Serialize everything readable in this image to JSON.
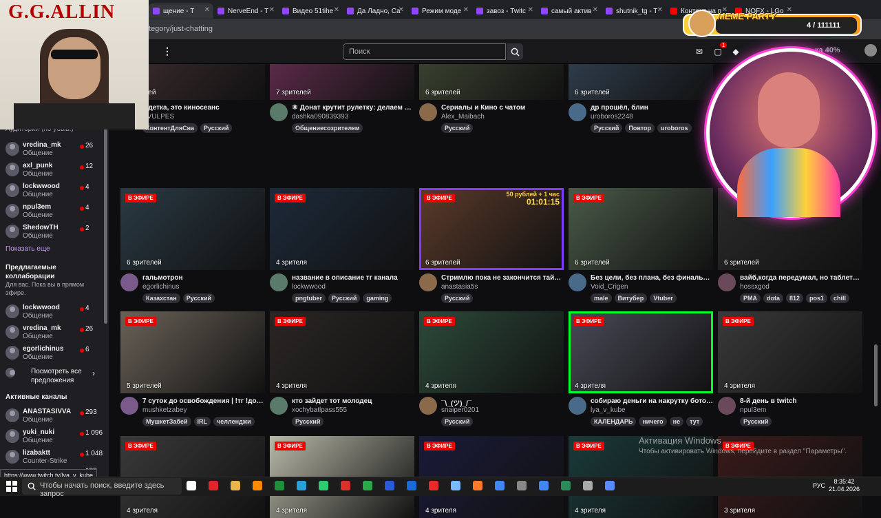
{
  "browser": {
    "tabs": [
      "щение - T",
      "NerveEnd - T",
      "Видео 51tihe",
      "Да Ладно, Са",
      "Режим моде",
      "завоз - Twitc",
      "самый актив",
      "shutnik_tg - T",
      "Контент на п",
      "NOFX - LGo"
    ],
    "url": "tegory/just-chatting"
  },
  "topnav": {
    "search_placeholder": "Поиск",
    "prime_text": "ка 40%",
    "notif_count": "1"
  },
  "sidebar": {
    "section_label": "Аудитории (по убыв.)",
    "followed": [
      {
        "name": "vredina_mk",
        "category": "Общение",
        "viewers": "26"
      },
      {
        "name": "axl_punk",
        "category": "Общение",
        "viewers": "12"
      },
      {
        "name": "lockwwood",
        "category": "Общение",
        "viewers": "4"
      },
      {
        "name": "npul3em",
        "category": "Общение",
        "viewers": "4"
      },
      {
        "name": "ShedowTH",
        "category": "Общение",
        "viewers": "2"
      }
    ],
    "show_more": "Показать еще",
    "collab_title": "Предлагаемые коллаборации",
    "collab_sub": "Для вас. Пока вы в прямом эфире.",
    "collabs": [
      {
        "name": "lockwwood",
        "category": "Общение",
        "viewers": "4"
      },
      {
        "name": "vredina_mk",
        "category": "Общение",
        "viewers": "26"
      },
      {
        "name": "egorlichinus",
        "category": "Общение",
        "viewers": "6"
      }
    ],
    "see_all": "Посмотреть все предложения",
    "active_title": "Активные каналы",
    "active": [
      {
        "name": "ANASTASIVVA",
        "category": "Общение",
        "viewers": "293"
      },
      {
        "name": "yuki_nuki",
        "category": "Общение",
        "viewers": "1 096"
      },
      {
        "name": "lizabaktt",
        "category": "Counter-Strike",
        "viewers": "1 048"
      },
      {
        "name": "",
        "category": "",
        "viewers": "128"
      }
    ]
  },
  "overlay": {
    "gg_allin": "G.G.ALLIN",
    "meme_title": "MEME PARTY",
    "meme_count": "4 / 111111"
  },
  "live_label": "В ЭФИРЕ",
  "cards": [
    {
      "viewers": "зрителей",
      "title": "а детка, это киносеанс",
      "channel": "EVULPES",
      "tags": [
        "КонтентДляСна",
        "Русский"
      ],
      "live": false
    },
    {
      "viewers": "7 зрителей",
      "title": "⚛ Донат крутит рулетку: делаем за…",
      "channel": "dashka090839393",
      "tags": [
        "Общениесозрителем"
      ],
      "live": false
    },
    {
      "viewers": "6 зрителей",
      "title": "Сериалы и Кино с чатом",
      "channel": "Alex_Maibach",
      "tags": [
        "Русский"
      ],
      "live": false
    },
    {
      "viewers": "6 зрителей",
      "title": "др прошёл, блин",
      "channel": "uroboros2248",
      "tags": [
        "Русский",
        "Повтор",
        "uroboros"
      ],
      "live": false
    },
    {
      "viewers": "6 зрителей",
      "title": "гальмотрон",
      "channel": "egorlichinus",
      "tags": [
        "Казахстан",
        "Русский"
      ],
      "live": true
    },
    {
      "viewers": "4 зрителя",
      "title": "название в описание тг канала",
      "channel": "lockwwood",
      "tags": [
        "pngtuber",
        "Русский",
        "gaming"
      ],
      "live": true
    },
    {
      "viewers": "6 зрителей",
      "title": "Стримлю пока не закончится таймер",
      "channel": "anastasia5s",
      "tags": [
        "Русский"
      ],
      "live": true,
      "sponsor": "50 рублей + 1 час",
      "timer": "01:01:15"
    },
    {
      "viewers": "6 зрителей",
      "title": "Без цели, без плана, без финального…",
      "channel": "Void_Crigen",
      "tags": [
        "male",
        "Витубер",
        "Vtuber"
      ],
      "live": true
    },
    {
      "viewers": "6 зрителей",
      "title": "вайб,когда передумал, но таблетки …",
      "channel": "hossxgod",
      "tags": [
        "PMA",
        "dota",
        "812",
        "pos1",
        "chill"
      ],
      "live": false
    },
    {
      "viewers": "5 зрителей",
      "title": "7 суток до освобождения | !тг !донат",
      "channel": "mushketzabey",
      "tags": [
        "МушкетЗабей",
        "IRL",
        "челленджи"
      ],
      "live": true
    },
    {
      "viewers": "4 зрителя",
      "title": "кто зайдет тот молодец",
      "channel": "xochybatlpass555",
      "tags": [
        "Русский"
      ],
      "live": true
    },
    {
      "viewers": "4 зрителя",
      "title": "¯\\_(ツ)_/¯",
      "channel": "snaiper0201",
      "tags": [
        "Русский"
      ],
      "live": true
    },
    {
      "viewers": "4 зрителя",
      "title": "собираю деньги на накрутку ботов | …",
      "channel": "lya_v_kube",
      "tags": [
        "КАЛЕНДАРЬ",
        "ничего",
        "не",
        "тут"
      ],
      "live": true
    },
    {
      "viewers": "4 зрителя",
      "title": "8-й день в twitch",
      "channel": "npul3em",
      "tags": [
        "Русский"
      ],
      "live": true
    },
    {
      "viewers": "4 зрителя",
      "title": "",
      "channel": "",
      "tags": [],
      "live": true
    },
    {
      "viewers": "4 зрителя",
      "title": "",
      "channel": "",
      "tags": [],
      "live": true
    },
    {
      "viewers": "4 зрителя",
      "title": "",
      "channel": "",
      "tags": [],
      "live": true
    },
    {
      "viewers": "4 зрителя",
      "title": "",
      "channel": "",
      "tags": [],
      "live": true
    },
    {
      "viewers": "3 зрителя",
      "title": "",
      "channel": "",
      "tags": [],
      "live": true
    }
  ],
  "windows": {
    "activation_title": "Активация Windows",
    "activation_sub": "Чтобы активировать Windows, перейдите в раздел \"Параметры\".",
    "status_url": "https://www.twitch.tv/lya_v_kube",
    "search_placeholder": "Чтобы начать поиск, введите здесь запрос",
    "lang": "РУС",
    "time": "8:35:42",
    "date": "21.04.2026"
  },
  "colors": {
    "accent": "#9147ff",
    "live": "#eb0400",
    "bg": "#0e0e10"
  }
}
